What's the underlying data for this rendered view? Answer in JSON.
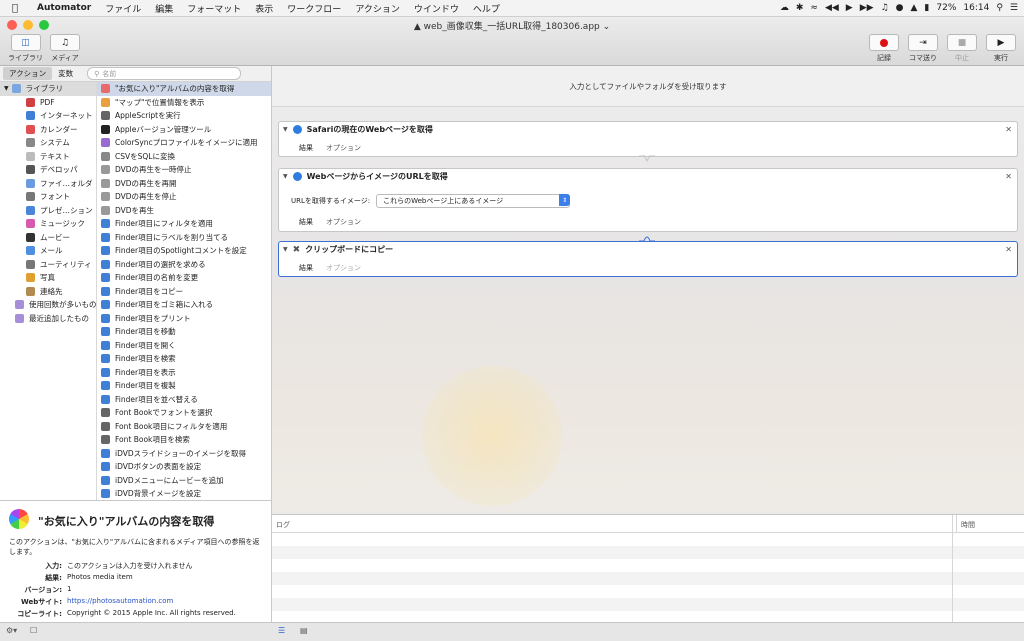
{
  "menubar": {
    "app": "Automator",
    "items": [
      "ファイル",
      "編集",
      "フォーマット",
      "表示",
      "ワークフロー",
      "アクション",
      "ウインドウ",
      "ヘルプ"
    ],
    "battery": "72%",
    "time": "16:14"
  },
  "window": {
    "title": "web_画像収集_一括URL取得_180306.app"
  },
  "toolbar": {
    "library_label": "ライブラリ",
    "media_label": "メディア",
    "record_label": "記録",
    "step_label": "コマ送り",
    "stop_label": "中止",
    "run_label": "実行"
  },
  "sidebar": {
    "seg_actions": "アクション",
    "seg_variables": "変数",
    "search_placeholder": "名前",
    "library": [
      {
        "label": "ライブラリ",
        "level": "top",
        "color": "#7aa7e0"
      },
      {
        "label": "PDF",
        "level": "sub",
        "color": "#d04040"
      },
      {
        "label": "インターネット",
        "level": "sub",
        "color": "#3f7fd6"
      },
      {
        "label": "カレンダー",
        "level": "sub",
        "color": "#e05050"
      },
      {
        "label": "システム",
        "level": "sub",
        "color": "#888888"
      },
      {
        "label": "テキスト",
        "level": "sub",
        "color": "#bbbbbb"
      },
      {
        "label": "デベロッパ",
        "level": "sub",
        "color": "#555555"
      },
      {
        "label": "ファイ…ォルダ",
        "level": "sub",
        "color": "#6a9be0"
      },
      {
        "label": "フォント",
        "level": "sub",
        "color": "#777777"
      },
      {
        "label": "プレゼ…ション",
        "level": "sub",
        "color": "#4a86d8"
      },
      {
        "label": "ミュージック",
        "level": "sub",
        "color": "#d85ab0"
      },
      {
        "label": "ムービー",
        "level": "sub",
        "color": "#333333"
      },
      {
        "label": "メール",
        "level": "sub",
        "color": "#4f8fe0"
      },
      {
        "label": "ユーティリティ",
        "level": "sub",
        "color": "#777777"
      },
      {
        "label": "写真",
        "level": "sub",
        "color": "#e0a030"
      },
      {
        "label": "連絡先",
        "level": "sub",
        "color": "#b08a50"
      },
      {
        "label": "使用回数が多いもの",
        "level": "lvl0",
        "color": "#a68ed8"
      },
      {
        "label": "最近追加したもの",
        "level": "lvl0",
        "color": "#a68ed8"
      }
    ],
    "actions": [
      {
        "label": "\"お気に入り\"アルバムの内容を取得",
        "color": "#e86a6a",
        "selected": true
      },
      {
        "label": "\"マップ\"で位置情報を表示",
        "color": "#e8a040"
      },
      {
        "label": "AppleScriptを実行",
        "color": "#666666"
      },
      {
        "label": "Appleバージョン管理ツール",
        "color": "#222222"
      },
      {
        "label": "ColorSyncプロファイルをイメージに適用",
        "color": "#9a6ad0"
      },
      {
        "label": "CSVをSQLに変換",
        "color": "#888888"
      },
      {
        "label": "DVDの再生を一時停止",
        "color": "#999999"
      },
      {
        "label": "DVDの再生を再開",
        "color": "#999999"
      },
      {
        "label": "DVDの再生を停止",
        "color": "#999999"
      },
      {
        "label": "DVDを再生",
        "color": "#999999"
      },
      {
        "label": "Finder項目にフィルタを適用",
        "color": "#3f7fd6"
      },
      {
        "label": "Finder項目にラベルを割り当てる",
        "color": "#3f7fd6"
      },
      {
        "label": "Finder項目のSpotlightコメントを設定",
        "color": "#3f7fd6"
      },
      {
        "label": "Finder項目の選択を求める",
        "color": "#3f7fd6"
      },
      {
        "label": "Finder項目の名前を変更",
        "color": "#3f7fd6"
      },
      {
        "label": "Finder項目をコピー",
        "color": "#3f7fd6"
      },
      {
        "label": "Finder項目をゴミ箱に入れる",
        "color": "#3f7fd6"
      },
      {
        "label": "Finder項目をプリント",
        "color": "#3f7fd6"
      },
      {
        "label": "Finder項目を移動",
        "color": "#3f7fd6"
      },
      {
        "label": "Finder項目を開く",
        "color": "#3f7fd6"
      },
      {
        "label": "Finder項目を検索",
        "color": "#3f7fd6"
      },
      {
        "label": "Finder項目を表示",
        "color": "#3f7fd6"
      },
      {
        "label": "Finder項目を複製",
        "color": "#3f7fd6"
      },
      {
        "label": "Finder項目を並べ替える",
        "color": "#3f7fd6"
      },
      {
        "label": "Font Bookでフォントを選択",
        "color": "#666666"
      },
      {
        "label": "Font Book項目にフィルタを適用",
        "color": "#666666"
      },
      {
        "label": "Font Book項目を検索",
        "color": "#666666"
      },
      {
        "label": "iDVDスライドショーのイメージを取得",
        "color": "#3f7fd6"
      },
      {
        "label": "iDVDボタンの表面を設定",
        "color": "#3f7fd6"
      },
      {
        "label": "iDVDメニューにムービーを追加",
        "color": "#3f7fd6"
      },
      {
        "label": "iDVD背景イメージを設定",
        "color": "#3f7fd6"
      }
    ]
  },
  "description": {
    "title": "\"お気に入り\"アルバムの内容を取得",
    "text": "このアクションは、\"お気に入り\"アルバムに含まれるメディア項目への参照を返します。",
    "fields": [
      {
        "key": "入力:",
        "value": "このアクションは入力を受け入れません"
      },
      {
        "key": "結果:",
        "value": "Photos media item"
      },
      {
        "key": "バージョン:",
        "value": "1"
      },
      {
        "key": "Webサイト:",
        "value": "https://photosautomation.com"
      },
      {
        "key": "コピーライト:",
        "value": "Copyright © 2015 Apple Inc. All rights reserved."
      }
    ]
  },
  "workflow": {
    "header": "入力としてファイルやフォルダを受け取ります",
    "actions": [
      {
        "title": "Safariの現在のWebページを取得",
        "results": "結果",
        "options": "オプション"
      },
      {
        "title": "WebページからイメージのURLを取得",
        "param_label": "URLを取得するイメージ:",
        "param_value": "これらのWebページ上にあるイメージ",
        "results": "結果",
        "options": "オプション"
      },
      {
        "title": "クリップボードにコピー",
        "results": "結果",
        "options": "オプション"
      }
    ]
  },
  "log": {
    "col_log": "ログ",
    "col_time": "時間"
  }
}
